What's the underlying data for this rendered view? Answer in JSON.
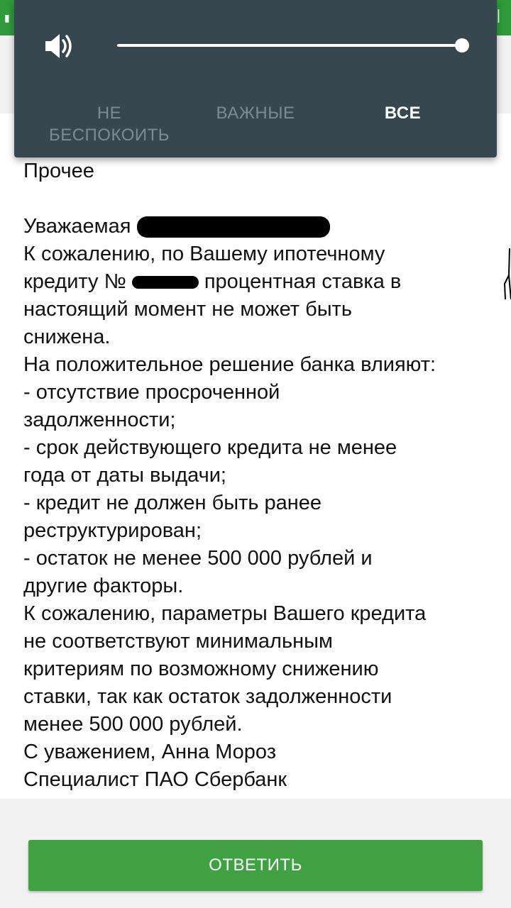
{
  "volume_panel": {
    "speaker_icon": "speaker-volume-icon",
    "level": 1.0,
    "modes": {
      "dnd_line1": "НЕ",
      "dnd_line2": "БЕСПОКОИТЬ",
      "important": "ВАЖНЫЕ",
      "all": "ВСЕ"
    },
    "selected_mode": "ВСЕ"
  },
  "message": {
    "category": "Прочее",
    "greeting": "Уважаемая",
    "line1": "К сожалению, по Вашему ипотечному",
    "line2_before": "кредиту №",
    "line2_after": "процентная ставка в",
    "line3": "настоящий момент не может быть",
    "line4": "снижена.",
    "line5": "На положительное решение банка влияют:",
    "line6": "- отсутствие просроченной",
    "line7": "задолженности;",
    "line8": "- срок действующего кредита не менее",
    "line9": "года от даты выдачи;",
    "line10": "- кредит не должен быть ранее",
    "line11": "реструктурирован;",
    "line12": "- остаток не менее 500 000 рублей и",
    "line13": "другие факторы.",
    "line14": "К сожалению, параметры Вашего кредита",
    "line15": "не соответствуют минимальным",
    "line16": "критериям по возможному снижению",
    "line17": "ставки, так как остаток задолженности",
    "line18": "менее 500 000 рублей.",
    "line19": "С уважением, Анна Мороз",
    "line20": "Специалист ПАО Сбербанк"
  },
  "reply_button": "ОТВЕТИТЬ",
  "colors": {
    "header_green": "#2e9a3b",
    "panel_bg": "#37474f",
    "button_green": "#3fa142"
  }
}
